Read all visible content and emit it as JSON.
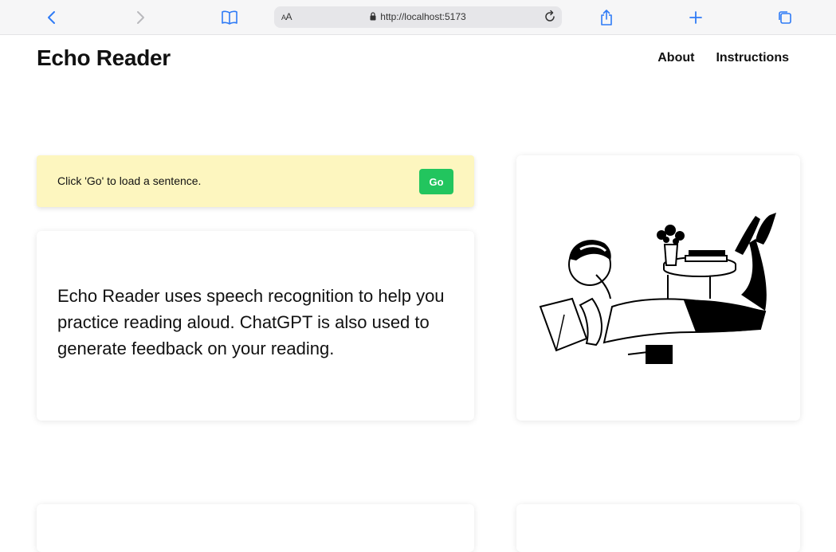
{
  "browser": {
    "text_size_label": "AA",
    "url": "http://localhost:5173",
    "icons": [
      "back-icon",
      "forward-icon",
      "bookmarks-icon",
      "lock-icon",
      "reload-icon",
      "share-icon",
      "new-tab-icon",
      "tabs-icon"
    ]
  },
  "header": {
    "title": "Echo Reader",
    "nav": [
      "About",
      "Instructions"
    ]
  },
  "prompt": {
    "message": "Click 'Go' to load a sentence.",
    "go_label": "Go",
    "background": "#fdf6bf",
    "button_color": "#22c55e"
  },
  "description": {
    "text": "Echo Reader uses speech recognition to help you practice reading aloud. ChatGPT is also used to generate feedback on your reading."
  },
  "illustration": {
    "subject": "woman-reading-book-illustration"
  }
}
